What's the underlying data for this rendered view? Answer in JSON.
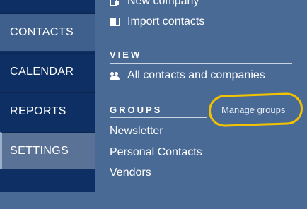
{
  "nav": {
    "items": [
      {
        "label": "CONTACTS"
      },
      {
        "label": "CALENDAR"
      },
      {
        "label": "REPORTS"
      },
      {
        "label": "SETTINGS"
      }
    ]
  },
  "actions": {
    "new_company": {
      "label": "New company",
      "icon": "new-company-icon"
    },
    "import_contacts": {
      "label": "Import contacts",
      "icon": "import-icon"
    }
  },
  "view": {
    "title": "VIEW",
    "items": [
      {
        "label": "All contacts and companies",
        "icon": "people-icon"
      }
    ]
  },
  "groups": {
    "title": "GROUPS",
    "manage_label": "Manage groups",
    "items": [
      {
        "label": "Newsletter"
      },
      {
        "label": "Personal Contacts"
      },
      {
        "label": "Vendors"
      }
    ]
  },
  "colors": {
    "nav_background": "#0d2f63",
    "panel_background": "#4a6a96",
    "highlight": "#f2c200"
  }
}
